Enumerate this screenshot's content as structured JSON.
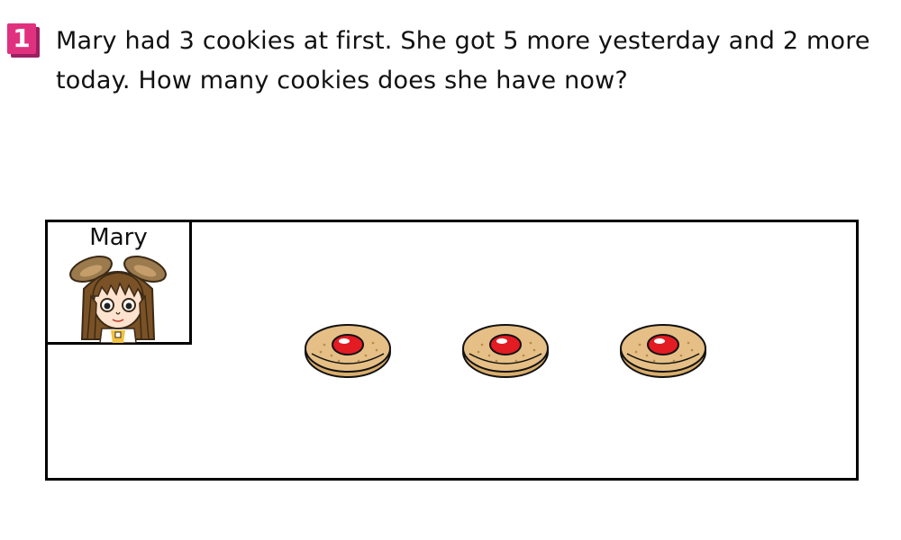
{
  "problem": {
    "number": "1",
    "number_color": "#e0317f",
    "text": "Mary had 3 cookies at first. She got 5 more yesterday and 2 more today. How many cookies does she have now?"
  },
  "scene": {
    "character": {
      "name": "Mary",
      "icon": "girl-with-bunny-ears-icon"
    },
    "cookies": {
      "count": 3,
      "icon": "cookie-icon",
      "cookie_color": "#e5bf85",
      "jam_color": "#e31b23"
    }
  }
}
